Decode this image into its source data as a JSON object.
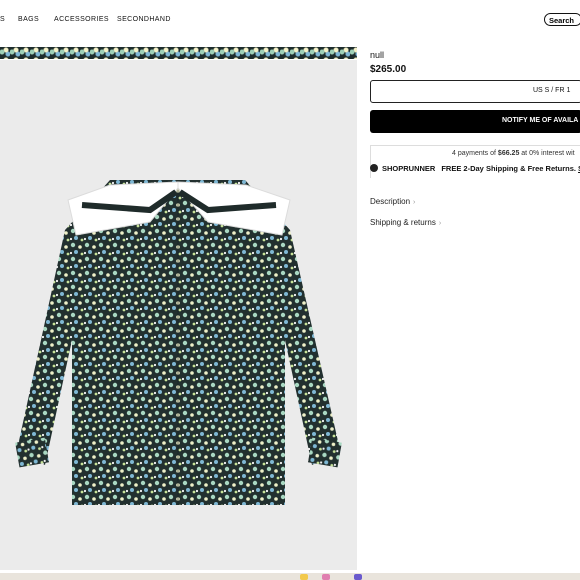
{
  "nav": {
    "items": [
      "S",
      "BAGS",
      "ACCESSORIES",
      "SECONDHAND"
    ],
    "search_label": "Search"
  },
  "product": {
    "title": "null",
    "price": "$265.00",
    "size_selector": "US S / FR 1",
    "notify_button": "NOTIFY ME OF AVAILA",
    "payments_prefix": "4 payments of ",
    "payments_amount": "$66.25",
    "payments_suffix": " at 0% interest wit",
    "shoprunner_brand": "SHOPRUNNER",
    "shoprunner_offer": "FREE 2-Day Shipping & Free Returns.",
    "shoprunner_link": "Si",
    "description_label": "Description",
    "shipping_label": "Shipping & returns"
  },
  "colors": {
    "accent": "#000000",
    "image_background": "#ebebeb"
  }
}
